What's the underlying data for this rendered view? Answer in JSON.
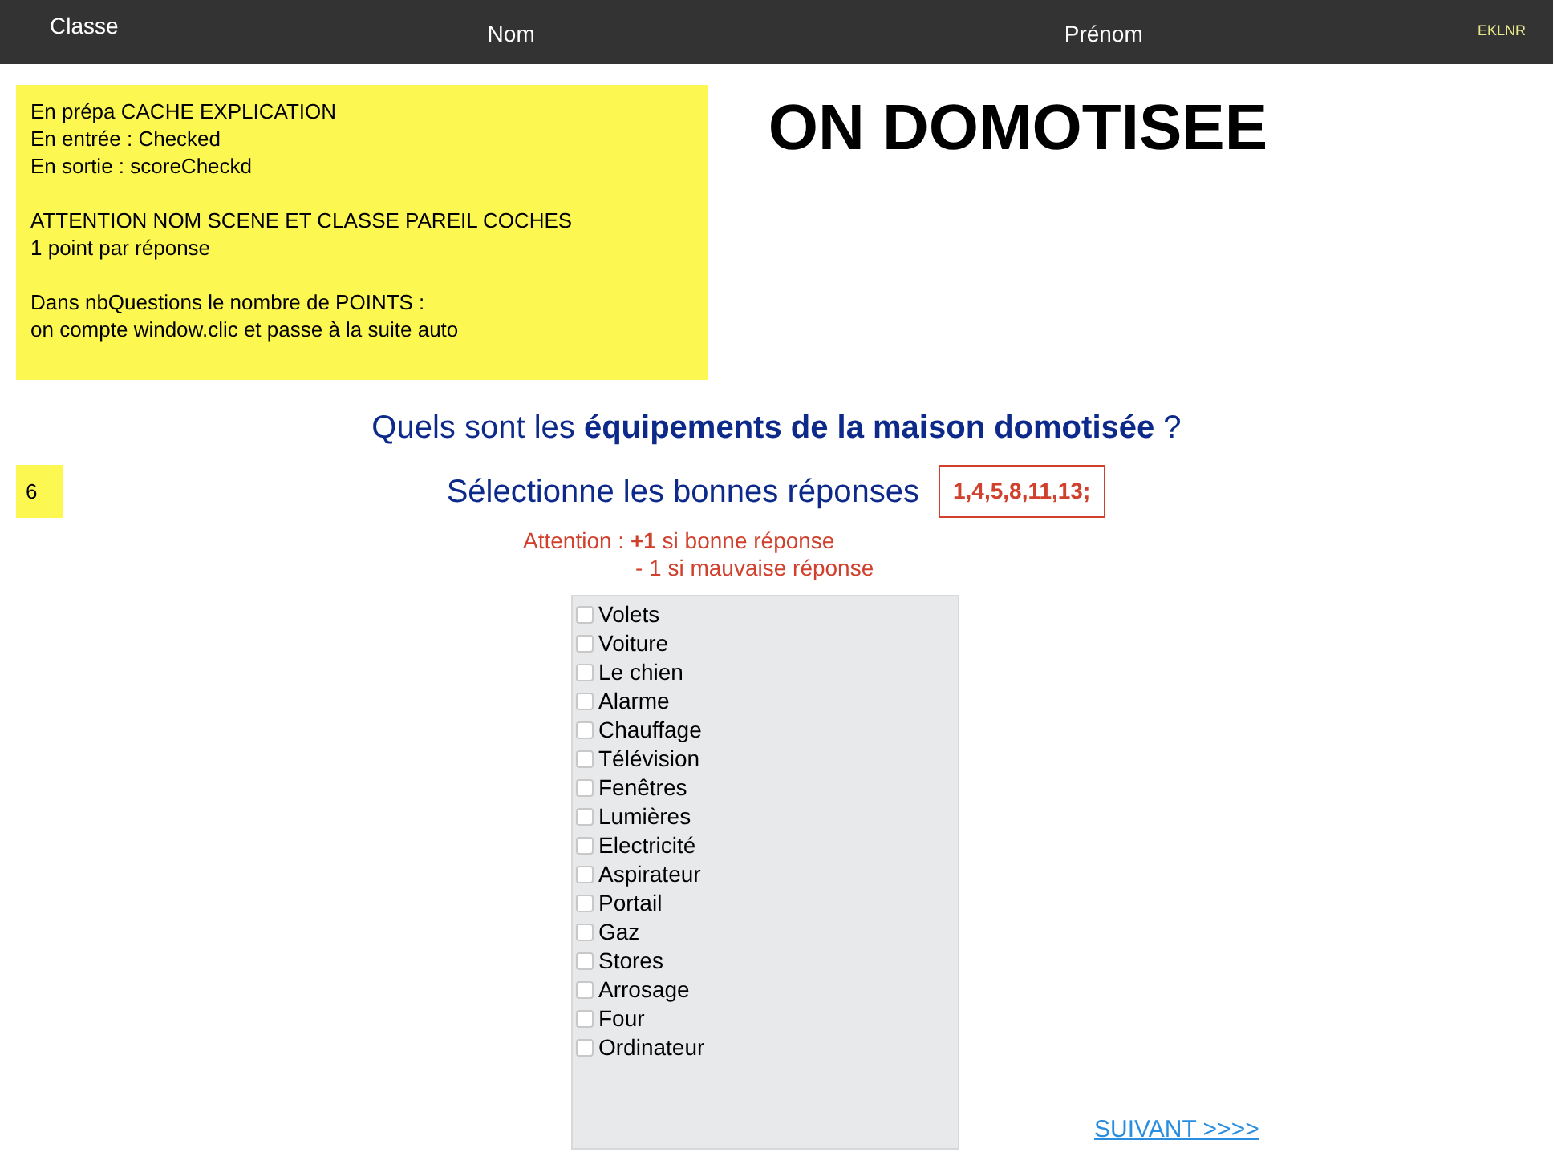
{
  "header": {
    "columns": [
      "Classe",
      "Nom",
      "Prénom"
    ],
    "badge": "EKLNR"
  },
  "note": {
    "paragraphs": [
      [
        "En prépa CACHE EXPLICATION",
        "En entrée : Checked",
        "En sortie : scoreCheckd"
      ],
      [
        "ATTENTION NOM SCENE ET CLASSE PAREIL COCHES",
        "1 point par réponse"
      ],
      [
        "Dans nbQuestions le nombre de POINTS :",
        "on compte window.clic et  passe à la suite auto"
      ]
    ]
  },
  "title": "ON DOMOTISEE",
  "question": "Quels sont les **équipements de la maison domotisée** ?",
  "instruction": "Sélectionne les bonnes réponses",
  "answer_key": "1,4,5,8,11,13;",
  "points_box": "6",
  "warning": [
    "Attention : **+1** si bonne réponse",
    "- 1 si mauvaise réponse"
  ],
  "options": [
    {
      "label": "Volets",
      "checked": false
    },
    {
      "label": "Voiture",
      "checked": false
    },
    {
      "label": "Le chien",
      "checked": false
    },
    {
      "label": "Alarme",
      "checked": false
    },
    {
      "label": "Chauffage",
      "checked": false
    },
    {
      "label": "Télévision",
      "checked": false
    },
    {
      "label": "Fenêtres",
      "checked": false
    },
    {
      "label": "Lumières",
      "checked": false
    },
    {
      "label": "Electricité",
      "checked": false
    },
    {
      "label": "Aspirateur",
      "checked": false
    },
    {
      "label": "Portail",
      "checked": false
    },
    {
      "label": "Gaz",
      "checked": false
    },
    {
      "label": "Stores",
      "checked": false
    },
    {
      "label": "Arrosage",
      "checked": false
    },
    {
      "label": "Four",
      "checked": false
    },
    {
      "label": "Ordinateur",
      "checked": false
    }
  ],
  "next_link": "SUIVANT >>>>"
}
